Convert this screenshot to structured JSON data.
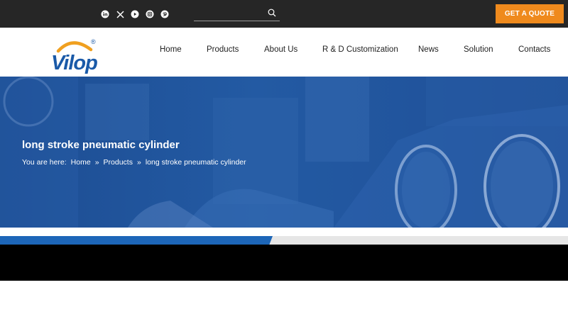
{
  "topbar": {
    "social_icons": [
      "linkedin-icon",
      "x-twitter-icon",
      "youtube-icon",
      "instagram-icon",
      "pinterest-icon"
    ],
    "search": {
      "placeholder": ""
    },
    "quote_label": "GET A QUOTE"
  },
  "header": {
    "logo_text": "Vilop",
    "registered_mark": "®",
    "nav": [
      "Home",
      "Products",
      "About Us",
      "R & D Customization",
      "News",
      "Solution",
      "Contacts"
    ]
  },
  "hero": {
    "title": "long stroke pneumatic cylinder",
    "breadcrumb": {
      "prefix": "You are here:",
      "items": [
        "Home",
        "Products",
        "long stroke pneumatic cylinder"
      ],
      "separator": "»"
    }
  },
  "colors": {
    "topbar": "#262626",
    "accent_orange": "#ef8a1d",
    "hero_blue": "#235aa3",
    "strip_blue": "#1d66b8"
  }
}
